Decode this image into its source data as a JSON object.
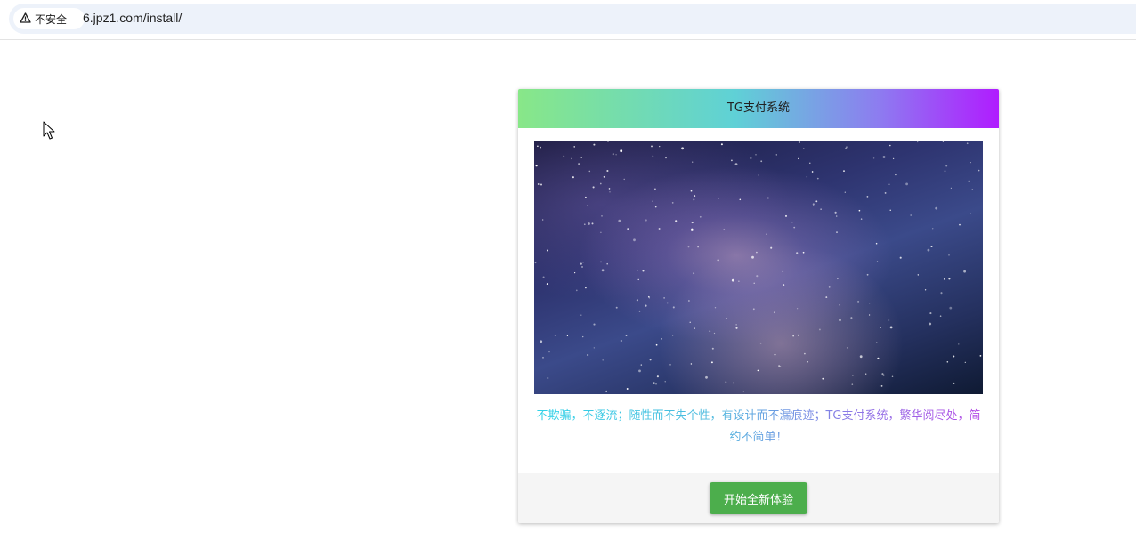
{
  "browser": {
    "security_label": "不安全",
    "url": "6.jpz1.com/install/"
  },
  "card": {
    "title": "TG支付系统",
    "tagline": "不欺骗，不逐流；随性而不失个性，有设计而不漏痕迹；TG支付系统，繁华阅尽处，简约不简单！",
    "button_label": "开始全新体验"
  },
  "colors": {
    "header_gradient": [
      "#88e788",
      "#5fd1d6",
      "#8d7cf0",
      "#b01cff"
    ],
    "button": "#4cae4c",
    "footer_bg": "#f5f5f5"
  },
  "icons": [
    "warning-triangle-icon",
    "mouse-pointer-icon"
  ]
}
